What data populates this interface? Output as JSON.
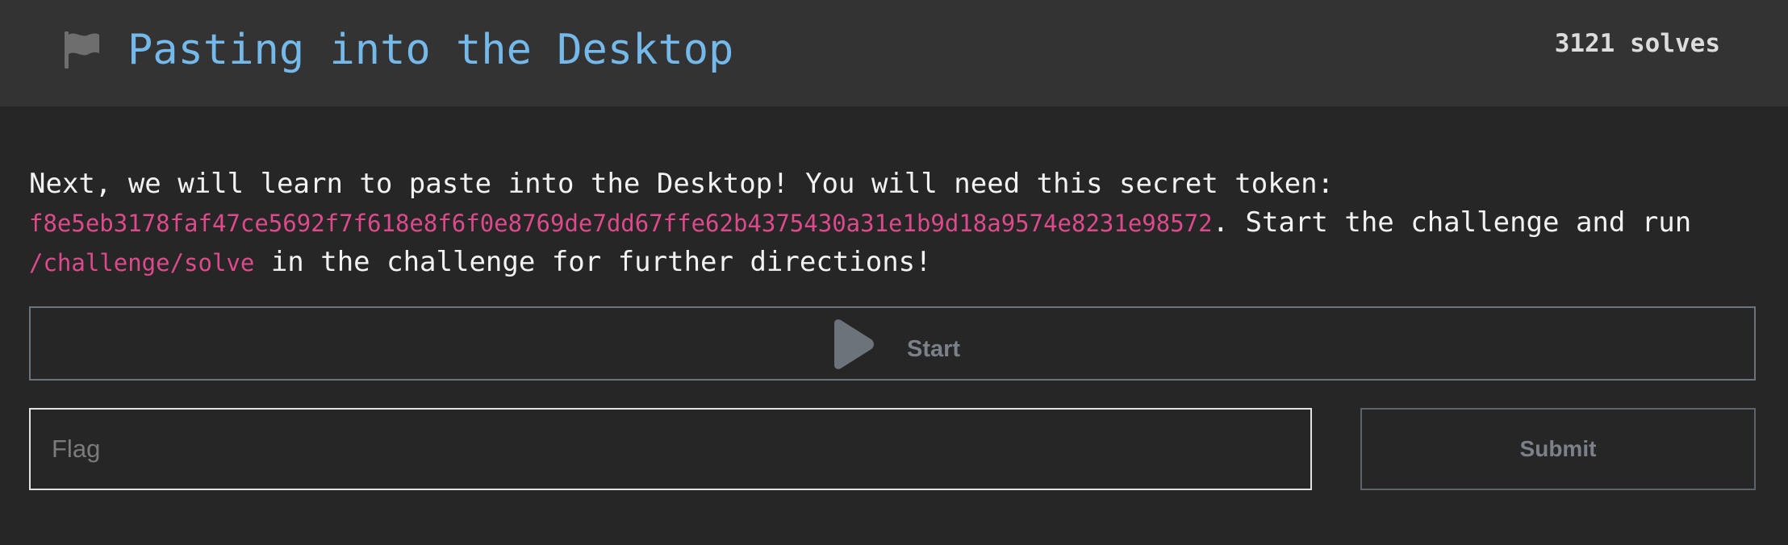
{
  "challenge": {
    "title": "Pasting into the Desktop",
    "solves": "3121 solves",
    "description": {
      "intro": "Next, we will learn to paste into the Desktop! You will need this secret token:",
      "token": "f8e5eb3178faf47ce5692f7f618e8f6f0e8769de7dd67ffe62b4375430a31e1b9d18a9574e8231e98572",
      "middle": ". Start the challenge and run",
      "command": "/challenge/solve",
      "outro": " in the challenge for further directions!"
    }
  },
  "actions": {
    "start_label": "Start",
    "flag_placeholder": "Flag",
    "flag_value": "",
    "submit_label": "Submit"
  },
  "colors": {
    "title": "#74b9ea",
    "code": "#dd4a8b",
    "header_bg": "#333333",
    "page_bg": "#262626"
  },
  "icons": {
    "header": "flag-icon",
    "start": "play-icon"
  }
}
